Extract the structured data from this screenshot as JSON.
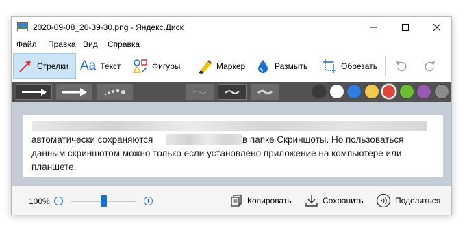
{
  "window": {
    "title": "2020-09-08_20-39-30.png - Яндекс.Диск"
  },
  "window_controls": [
    "minimize",
    "maximize",
    "close"
  ],
  "menu": [
    {
      "accel": "Ф",
      "rest": "айл"
    },
    {
      "accel": "П",
      "rest": "равка"
    },
    {
      "accel": "В",
      "rest": "ид"
    },
    {
      "accel": "С",
      "rest": "правка"
    }
  ],
  "toolbar": {
    "arrows": "Стрелки",
    "text": "Текст",
    "shapes": "Фигуры",
    "marker": "Маркер",
    "blur": "Размыть",
    "crop": "Обрезать",
    "text_icon_glyph": "Aa"
  },
  "colors": [
    "#3a3a3a",
    "#ffffff",
    "#2f7de1",
    "#f2c94c",
    "#e0473c",
    "#6abf2e",
    "#9b59b6",
    "#8c8c8c"
  ],
  "selected_color": "#e0473c",
  "content": {
    "line1": "автоматически сохраняются",
    "line1b": "в папке Скриншоты. Но пользоваться",
    "line2": "данным скриншотом можно только если установлено приложение на компьютере или",
    "line3": "планшете."
  },
  "status": {
    "zoom": "100%",
    "zoom_level": 0.5,
    "copy": "Копировать",
    "save": "Сохранить",
    "share": "Поделиться"
  }
}
